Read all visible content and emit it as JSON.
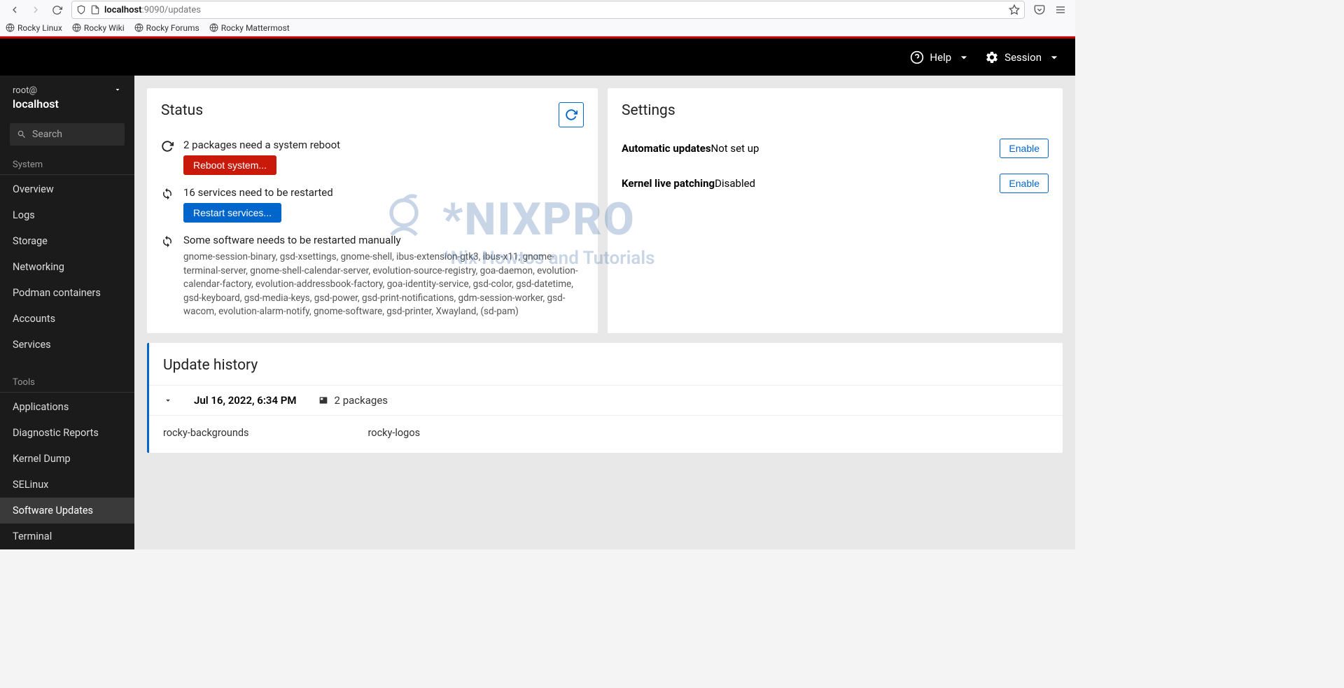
{
  "browser": {
    "url_host": "localhost",
    "url_path": ":9090/updates",
    "bookmarks": [
      "Rocky Linux",
      "Rocky Wiki",
      "Rocky Forums",
      "Rocky Mattermost"
    ]
  },
  "topbar": {
    "help": "Help",
    "session": "Session"
  },
  "host": {
    "user": "root@",
    "host": "localhost"
  },
  "search": {
    "placeholder": "Search"
  },
  "nav": {
    "sec_system": "System",
    "sec_tools": "Tools",
    "items_system": [
      "Overview",
      "Logs",
      "Storage",
      "Networking",
      "Podman containers",
      "Accounts",
      "Services"
    ],
    "items_tools": [
      "Applications",
      "Diagnostic Reports",
      "Kernel Dump",
      "SELinux",
      "Software Updates",
      "Terminal"
    ],
    "active": "Software Updates"
  },
  "status": {
    "title": "Status",
    "reboot_msg": "2 packages need a system reboot",
    "reboot_btn": "Reboot system...",
    "restart_msg": "16 services need to be restarted",
    "restart_btn": "Restart services...",
    "manual_msg": "Some software needs to be restarted manually",
    "manual_list": "gnome-session-binary, gsd-xsettings, gnome-shell, ibus-extension-gtk3, ibus-x11, gnome-terminal-server, gnome-shell-calendar-server, evolution-source-registry, goa-daemon, evolution-calendar-factory, evolution-addressbook-factory, goa-identity-service, gsd-color, gsd-datetime, gsd-keyboard, gsd-media-keys, gsd-power, gsd-print-notifications, gdm-session-worker, gsd-wacom, evolution-alarm-notify, gnome-software, gsd-printer, Xwayland, (sd-pam)"
  },
  "settings": {
    "title": "Settings",
    "auto_label": "Automatic updates",
    "auto_value": "Not set up",
    "kernel_label": "Kernel live patching",
    "kernel_value": "Disabled",
    "enable": "Enable"
  },
  "history": {
    "title": "Update history",
    "date": "Jul 16, 2022, 6:34 PM",
    "count": "2 packages",
    "packages": [
      "rocky-backgrounds",
      "rocky-logos"
    ]
  },
  "watermark": {
    "title": "*NIXPRO",
    "sub": "*Nix Howtos and Tutorials"
  }
}
